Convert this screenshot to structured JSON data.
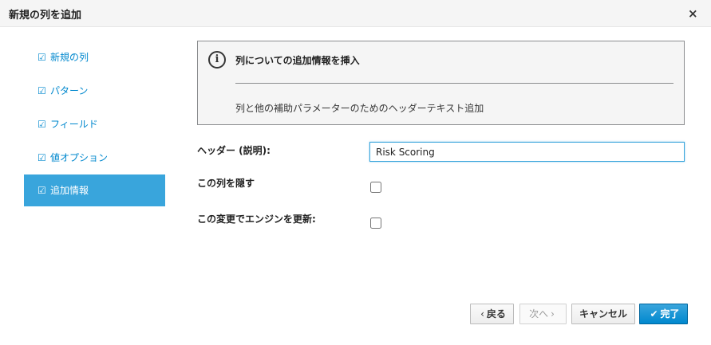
{
  "dialog": {
    "title": "新規の列を追加",
    "close_glyph": "×"
  },
  "steps": [
    {
      "label": "新規の列",
      "check": "☑"
    },
    {
      "label": "パターン",
      "check": "☑"
    },
    {
      "label": "フィールド",
      "check": "☑"
    },
    {
      "label": "値オプション",
      "check": "☑"
    },
    {
      "label": "追加情報",
      "check": "☑",
      "active": true
    }
  ],
  "info": {
    "icon": "i",
    "title": "列についての追加情報を挿入",
    "text": "列と他の補助パラメーターのためのヘッダーテキスト追加"
  },
  "form": {
    "header_label": "ヘッダー (説明):",
    "header_value": "Risk Scoring",
    "hide_label": "この列を隠す",
    "hide_checked": false,
    "update_label": "この変更でエンジンを更新:",
    "update_checked": false
  },
  "buttons": {
    "back_glyph": "‹",
    "back": "戻る",
    "next": "次へ",
    "next_glyph": "›",
    "cancel": "キャンセル",
    "finish_glyph": "✔",
    "finish": "完了"
  },
  "colors": {
    "accent": "#39a5dc",
    "link": "#0088ce",
    "primary_button": "#0088ce"
  }
}
